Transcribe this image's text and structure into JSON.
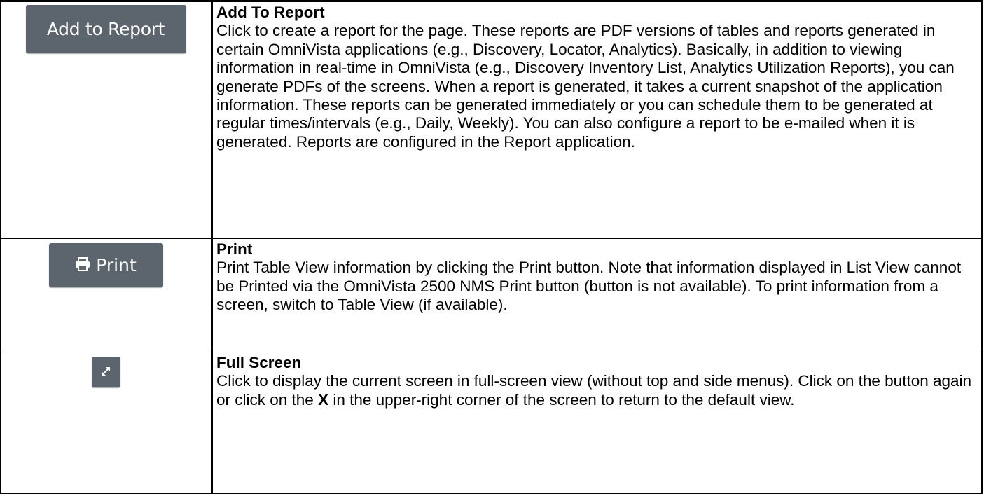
{
  "rows": [
    {
      "button": {
        "label": "Add to Report",
        "icon": null
      },
      "title": "Add To Report",
      "description": "Click to create a report for the page. These reports are PDF versions of tables and reports generated in certain OmniVista applications (e.g., Discovery, Locator, Analytics). Basically, in addition to viewing information in real-time in OmniVista (e.g., Discovery Inventory List, Analytics Utilization Reports), you can generate PDFs of the screens. When a report is generated, it takes a current snapshot of the application information. These reports can be generated immediately or you can schedule them to be generated at regular times/intervals (e.g., Daily, Weekly). You can also configure a report to be e-mailed when it is generated. Reports are configured in the Report application."
    },
    {
      "button": {
        "label": "Print",
        "icon": "printer-icon"
      },
      "title": "Print",
      "description": "Print Table View information by clicking the Print button. Note that information displayed in List View cannot be Printed via the OmniVista 2500 NMS Print button (button is not available). To print information from a screen, switch to Table View (if available)."
    },
    {
      "button": {
        "label": "",
        "icon": "expand-icon"
      },
      "title": "Full Screen",
      "description_before": "Click to display the current screen in full-screen view (without top and side menus). Click on the button again or click on the ",
      "description_bold": "X",
      "description_after": " in the upper-right corner of the screen to return to the default view."
    }
  ],
  "colors": {
    "button_bg": "#5c656d",
    "button_text": "#ffffff",
    "border": "#000000"
  }
}
